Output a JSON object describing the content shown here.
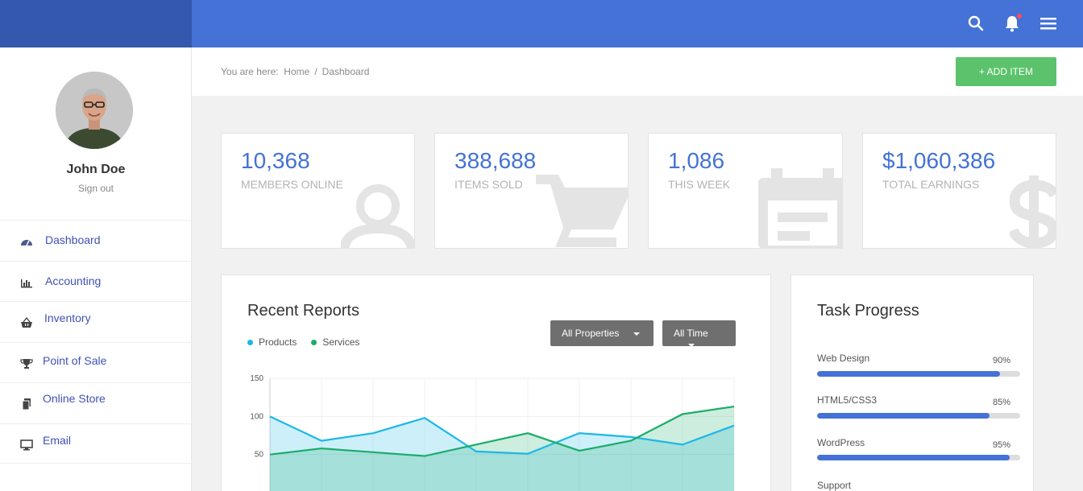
{
  "header": {
    "icons": [
      "search-icon",
      "bell-icon",
      "menu-icon"
    ],
    "accent": "#4472d6"
  },
  "user": {
    "name": "John Doe",
    "signout_label": "Sign out"
  },
  "nav": [
    {
      "label": "Dashboard",
      "icon": "dashboard-icon"
    },
    {
      "label": "Accounting",
      "icon": "bar-chart-icon"
    },
    {
      "label": "Inventory",
      "icon": "basket-icon"
    },
    {
      "label": "Point of Sale",
      "icon": "trophy-icon"
    },
    {
      "label": "Online Store",
      "icon": "files-icon"
    },
    {
      "label": "Email",
      "icon": "monitor-icon"
    }
  ],
  "breadcrumb": {
    "prefix": "You are here:",
    "home": "Home",
    "sep": "/",
    "current": "Dashboard"
  },
  "add_button": "+ ADD ITEM",
  "stats": [
    {
      "value": "10,368",
      "label": "MEMBERS ONLINE",
      "icon": "user-icon"
    },
    {
      "value": "388,688",
      "label": "ITEMS SOLD",
      "icon": "cart-icon"
    },
    {
      "value": "1,086",
      "label": "THIS WEEK",
      "icon": "calendar-icon"
    },
    {
      "value": "$1,060,386",
      "label": "TOTAL EARNINGS",
      "icon": "dollar-icon"
    }
  ],
  "reports": {
    "title": "Recent Reports",
    "filter_properties": "All Properties",
    "filter_time": "All Time",
    "legend": [
      {
        "name": "Products",
        "color": "#1cb8e6"
      },
      {
        "name": "Services",
        "color": "#1aad6a"
      }
    ]
  },
  "chart_data": {
    "type": "area",
    "title": "Recent Reports",
    "x": [
      0,
      1,
      2,
      3,
      4,
      5,
      6,
      7,
      8,
      9
    ],
    "ylim": [
      0,
      150
    ],
    "yticks": [
      50,
      100,
      150
    ],
    "grid": true,
    "legend_position": "top-left",
    "series": [
      {
        "name": "Products",
        "color": "#1cb8e6",
        "values": [
          100,
          68,
          78,
          98,
          54,
          51,
          78,
          73,
          63,
          88
        ]
      },
      {
        "name": "Services",
        "color": "#1aad6a",
        "values": [
          50,
          58,
          53,
          48,
          63,
          78,
          55,
          68,
          103,
          113
        ]
      }
    ]
  },
  "tasks": {
    "title": "Task Progress",
    "items": [
      {
        "label": "Web Design",
        "pct_text": "90%",
        "pct": 90
      },
      {
        "label": "HTML5/CSS3",
        "pct_text": "85%",
        "pct": 85
      },
      {
        "label": "WordPress",
        "pct_text": "95%",
        "pct": 95
      },
      {
        "label": "Support"
      }
    ]
  }
}
